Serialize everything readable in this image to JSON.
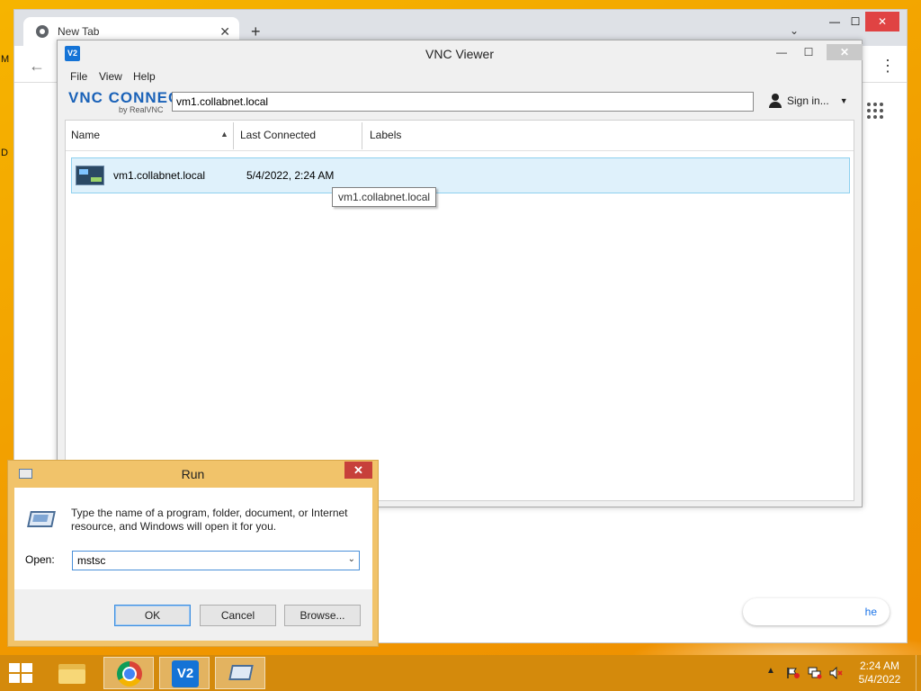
{
  "desktop": {
    "edge_letters": [
      "M",
      "D"
    ]
  },
  "chrome": {
    "tab_title": "New Tab",
    "new_tab_glyph": "+",
    "close_glyph": "✕",
    "minimize_glyph": "—",
    "maximize_glyph": "☐",
    "customize_partial": "he"
  },
  "vnc": {
    "title": "VNC Viewer",
    "app_icon_text": "V2",
    "menu": [
      "File",
      "View",
      "Help"
    ],
    "logo_main": "VNC CONNECT",
    "logo_sub": "by RealVNC",
    "address_value": "vm1.collabnet.local",
    "sign_in": "Sign in...",
    "columns": [
      "Name",
      "Last Connected",
      "Labels"
    ],
    "rows": [
      {
        "name": "vm1.collabnet.local",
        "last_connected": "5/4/2022, 2:24 AM",
        "labels": ""
      }
    ],
    "tooltip": "vm1.collabnet.local"
  },
  "run": {
    "title": "Run",
    "description": "Type the name of a program, folder, document, or Internet resource, and Windows will open it for you.",
    "open_label": "Open:",
    "open_value": "mstsc",
    "buttons": {
      "ok": "OK",
      "cancel": "Cancel",
      "browse": "Browse..."
    }
  },
  "taskbar": {
    "vnc_icon_text": "V2",
    "time": "2:24 AM",
    "date": "5/4/2022"
  },
  "colors": {
    "desktop_bg": "#f3a500",
    "taskbar_bg": "#d48a0c",
    "selection_bg": "#dff1fb",
    "run_frame": "#f1c36a",
    "close_red": "#c7403a",
    "vnc_blue": "#1473d6"
  }
}
